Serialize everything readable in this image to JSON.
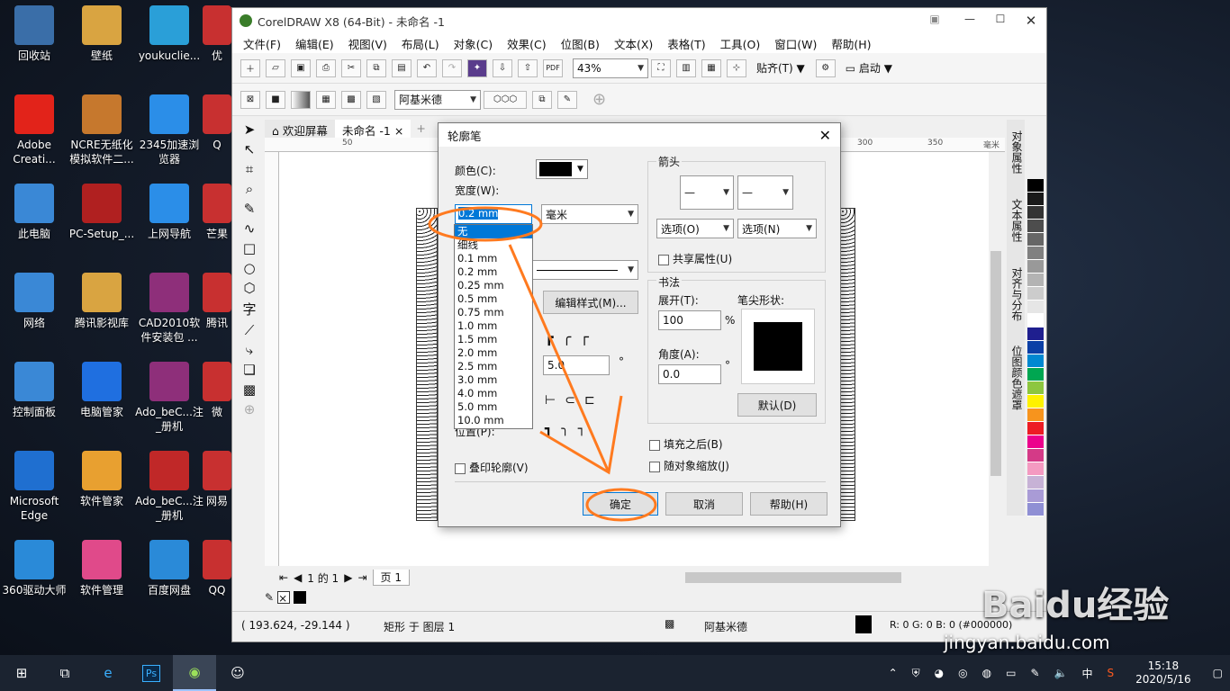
{
  "desktop": {
    "icons": [
      {
        "label": "回收站",
        "icon": "recycle-bin-icon",
        "color": "#3a6ea8"
      },
      {
        "label": "壁纸",
        "icon": "folder-icon",
        "color": "#d9a441"
      },
      {
        "label": "youkuclie...",
        "icon": "youku-icon",
        "color": "#2a9fd8"
      },
      {
        "label": "Adobe Creati...",
        "icon": "adobe-cc-icon",
        "color": "#e2231a"
      },
      {
        "label": "NCRE无纸化模拟软件二...",
        "icon": "ncre-icon",
        "color": "#c6782d"
      },
      {
        "label": "2345加速浏览器",
        "icon": "browser-icon",
        "color": "#2b8ee8"
      },
      {
        "label": "此电脑",
        "icon": "computer-icon",
        "color": "#3a88d6"
      },
      {
        "label": "PC-Setup_...",
        "icon": "pc-setup-icon",
        "color": "#b02020"
      },
      {
        "label": "上网导航",
        "icon": "ie-icon",
        "color": "#2b8ee8"
      },
      {
        "label": "网络",
        "icon": "network-icon",
        "color": "#3a88d6"
      },
      {
        "label": "腾讯影视库",
        "icon": "folder-icon",
        "color": "#d9a441"
      },
      {
        "label": "CAD2010软件安装包 ...",
        "icon": "winrar-icon",
        "color": "#8e2f7a"
      },
      {
        "label": "控制面板",
        "icon": "control-panel-icon",
        "color": "#3a88d6"
      },
      {
        "label": "电脑管家",
        "icon": "shield-icon",
        "color": "#1f6fe0"
      },
      {
        "label": "Ado_beC...注_册机",
        "icon": "winrar-icon",
        "color": "#8e2f7a"
      },
      {
        "label": "Microsoft Edge",
        "icon": "edge-icon",
        "color": "#1f6fd0"
      },
      {
        "label": "软件管家",
        "icon": "software-manager-icon",
        "color": "#e8a030"
      },
      {
        "label": "Ado_beC...注_册机",
        "icon": "registry-tool-icon",
        "color": "#c02828"
      },
      {
        "label": "360驱动大师",
        "icon": "driver-icon",
        "color": "#2a8ad8"
      },
      {
        "label": "软件管理",
        "icon": "app-manager-icon",
        "color": "#e04a8a"
      },
      {
        "label": "百度网盘",
        "icon": "baidu-netdisk-icon",
        "color": "#2a8ad8"
      }
    ],
    "partial": [
      "优",
      "Q",
      "芒果",
      "腾讯",
      "微",
      "网易",
      "QQ"
    ]
  },
  "window": {
    "title": "CorelDRAW X8 (64-Bit) - 未命名 -1",
    "menus": [
      "文件(F)",
      "编辑(E)",
      "视图(V)",
      "布局(L)",
      "对象(C)",
      "效果(C)",
      "位图(B)",
      "文本(X)",
      "表格(T)",
      "工具(O)",
      "窗口(W)",
      "帮助(H)"
    ],
    "zoom": "43%",
    "snap": "贴齐(T)",
    "launch": "启动",
    "font": "阿基米德",
    "tabs": [
      "欢迎屏幕",
      "未命名 -1"
    ],
    "ruler_marks": [
      "50",
      "300",
      "350"
    ],
    "ruler_unit": "毫米",
    "page_nav": "1 的 1",
    "page_tab": "页 1",
    "status": {
      "coords": "( 193.624, -29.144 )",
      "object": "矩形 于 图层 1",
      "fill_name": "阿基米德",
      "color_info": "R: 0 G: 0 B: 0 (#000000)"
    },
    "dockers": [
      "对象属性",
      "文本属性",
      "对齐与分布",
      "位图颜色遮罩"
    ]
  },
  "dialog": {
    "title": "轮廓笔",
    "color_label": "颜色(C):",
    "width_label": "宽度(W):",
    "width_value": "0.2 mm",
    "unit": "毫米",
    "width_options": [
      "无",
      "细线",
      "0.1 mm",
      "0.2 mm",
      "0.25 mm",
      "0.5 mm",
      "0.75 mm",
      "1.0 mm",
      "1.5 mm",
      "2.0 mm",
      "2.5 mm",
      "3.0 mm",
      "4.0 mm",
      "5.0 mm",
      "10.0 mm"
    ],
    "edit_style": "编辑样式(M)...",
    "miter_value": "5.0",
    "degree": "°",
    "position_label": "位置(P):",
    "overprint": "叠印轮廓(V)",
    "arrows_label": "箭头",
    "option1": "选项(O)",
    "option2": "选项(N)",
    "share": "共享属性(U)",
    "calligraphy": "书法",
    "stretch_label": "展开(T):",
    "stretch_value": "100",
    "percent": "%",
    "angle_label": "角度(A):",
    "angle_value": "0.0",
    "nib_label": "笔尖形状:",
    "default_btn": "默认(D)",
    "fill_behind": "填充之后(B)",
    "scale": "随对象缩放(J)",
    "ok": "确定",
    "cancel": "取消",
    "help": "帮助(H)"
  },
  "taskbar": {
    "time": "15:18",
    "date": "2020/5/16",
    "ime": "中"
  },
  "watermark": {
    "brand": "Baidu经验",
    "url": "jingyan.baidu.com"
  },
  "colors": {
    "annotation": "#ff7a1f",
    "highlight": "#0078d7"
  },
  "palette": [
    "#000000",
    "#1a1a1a",
    "#333333",
    "#4d4d4d",
    "#666666",
    "#808080",
    "#999999",
    "#b3b3b3",
    "#cccccc",
    "#e6e6e6",
    "#ffffff",
    "#1f1f8f",
    "#0b3fa6",
    "#0088d1",
    "#00a651",
    "#8dc63f",
    "#fff200",
    "#f7941d",
    "#ed1c24",
    "#ec008c",
    "#d43a87",
    "#f49ac1",
    "#c7b2d6",
    "#a99bd6",
    "#8f8fd4"
  ]
}
